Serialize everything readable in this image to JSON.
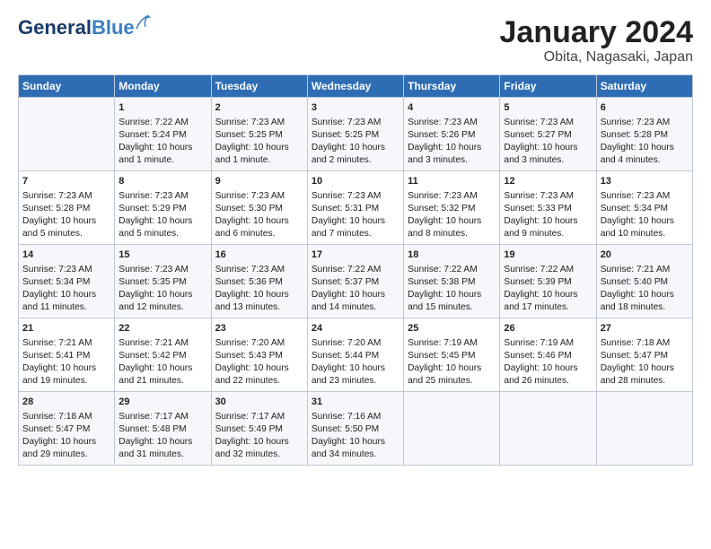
{
  "header": {
    "logo_general": "General",
    "logo_blue": "Blue",
    "title": "January 2024",
    "subtitle": "Obita, Nagasaki, Japan"
  },
  "days_of_week": [
    "Sunday",
    "Monday",
    "Tuesday",
    "Wednesday",
    "Thursday",
    "Friday",
    "Saturday"
  ],
  "weeks": [
    [
      {
        "day": "",
        "info": ""
      },
      {
        "day": "1",
        "info": "Sunrise: 7:22 AM\nSunset: 5:24 PM\nDaylight: 10 hours\nand 1 minute."
      },
      {
        "day": "2",
        "info": "Sunrise: 7:23 AM\nSunset: 5:25 PM\nDaylight: 10 hours\nand 1 minute."
      },
      {
        "day": "3",
        "info": "Sunrise: 7:23 AM\nSunset: 5:25 PM\nDaylight: 10 hours\nand 2 minutes."
      },
      {
        "day": "4",
        "info": "Sunrise: 7:23 AM\nSunset: 5:26 PM\nDaylight: 10 hours\nand 3 minutes."
      },
      {
        "day": "5",
        "info": "Sunrise: 7:23 AM\nSunset: 5:27 PM\nDaylight: 10 hours\nand 3 minutes."
      },
      {
        "day": "6",
        "info": "Sunrise: 7:23 AM\nSunset: 5:28 PM\nDaylight: 10 hours\nand 4 minutes."
      }
    ],
    [
      {
        "day": "7",
        "info": "Sunrise: 7:23 AM\nSunset: 5:28 PM\nDaylight: 10 hours\nand 5 minutes."
      },
      {
        "day": "8",
        "info": "Sunrise: 7:23 AM\nSunset: 5:29 PM\nDaylight: 10 hours\nand 5 minutes."
      },
      {
        "day": "9",
        "info": "Sunrise: 7:23 AM\nSunset: 5:30 PM\nDaylight: 10 hours\nand 6 minutes."
      },
      {
        "day": "10",
        "info": "Sunrise: 7:23 AM\nSunset: 5:31 PM\nDaylight: 10 hours\nand 7 minutes."
      },
      {
        "day": "11",
        "info": "Sunrise: 7:23 AM\nSunset: 5:32 PM\nDaylight: 10 hours\nand 8 minutes."
      },
      {
        "day": "12",
        "info": "Sunrise: 7:23 AM\nSunset: 5:33 PM\nDaylight: 10 hours\nand 9 minutes."
      },
      {
        "day": "13",
        "info": "Sunrise: 7:23 AM\nSunset: 5:34 PM\nDaylight: 10 hours\nand 10 minutes."
      }
    ],
    [
      {
        "day": "14",
        "info": "Sunrise: 7:23 AM\nSunset: 5:34 PM\nDaylight: 10 hours\nand 11 minutes."
      },
      {
        "day": "15",
        "info": "Sunrise: 7:23 AM\nSunset: 5:35 PM\nDaylight: 10 hours\nand 12 minutes."
      },
      {
        "day": "16",
        "info": "Sunrise: 7:23 AM\nSunset: 5:36 PM\nDaylight: 10 hours\nand 13 minutes."
      },
      {
        "day": "17",
        "info": "Sunrise: 7:22 AM\nSunset: 5:37 PM\nDaylight: 10 hours\nand 14 minutes."
      },
      {
        "day": "18",
        "info": "Sunrise: 7:22 AM\nSunset: 5:38 PM\nDaylight: 10 hours\nand 15 minutes."
      },
      {
        "day": "19",
        "info": "Sunrise: 7:22 AM\nSunset: 5:39 PM\nDaylight: 10 hours\nand 17 minutes."
      },
      {
        "day": "20",
        "info": "Sunrise: 7:21 AM\nSunset: 5:40 PM\nDaylight: 10 hours\nand 18 minutes."
      }
    ],
    [
      {
        "day": "21",
        "info": "Sunrise: 7:21 AM\nSunset: 5:41 PM\nDaylight: 10 hours\nand 19 minutes."
      },
      {
        "day": "22",
        "info": "Sunrise: 7:21 AM\nSunset: 5:42 PM\nDaylight: 10 hours\nand 21 minutes."
      },
      {
        "day": "23",
        "info": "Sunrise: 7:20 AM\nSunset: 5:43 PM\nDaylight: 10 hours\nand 22 minutes."
      },
      {
        "day": "24",
        "info": "Sunrise: 7:20 AM\nSunset: 5:44 PM\nDaylight: 10 hours\nand 23 minutes."
      },
      {
        "day": "25",
        "info": "Sunrise: 7:19 AM\nSunset: 5:45 PM\nDaylight: 10 hours\nand 25 minutes."
      },
      {
        "day": "26",
        "info": "Sunrise: 7:19 AM\nSunset: 5:46 PM\nDaylight: 10 hours\nand 26 minutes."
      },
      {
        "day": "27",
        "info": "Sunrise: 7:18 AM\nSunset: 5:47 PM\nDaylight: 10 hours\nand 28 minutes."
      }
    ],
    [
      {
        "day": "28",
        "info": "Sunrise: 7:18 AM\nSunset: 5:47 PM\nDaylight: 10 hours\nand 29 minutes."
      },
      {
        "day": "29",
        "info": "Sunrise: 7:17 AM\nSunset: 5:48 PM\nDaylight: 10 hours\nand 31 minutes."
      },
      {
        "day": "30",
        "info": "Sunrise: 7:17 AM\nSunset: 5:49 PM\nDaylight: 10 hours\nand 32 minutes."
      },
      {
        "day": "31",
        "info": "Sunrise: 7:16 AM\nSunset: 5:50 PM\nDaylight: 10 hours\nand 34 minutes."
      },
      {
        "day": "",
        "info": ""
      },
      {
        "day": "",
        "info": ""
      },
      {
        "day": "",
        "info": ""
      }
    ]
  ]
}
